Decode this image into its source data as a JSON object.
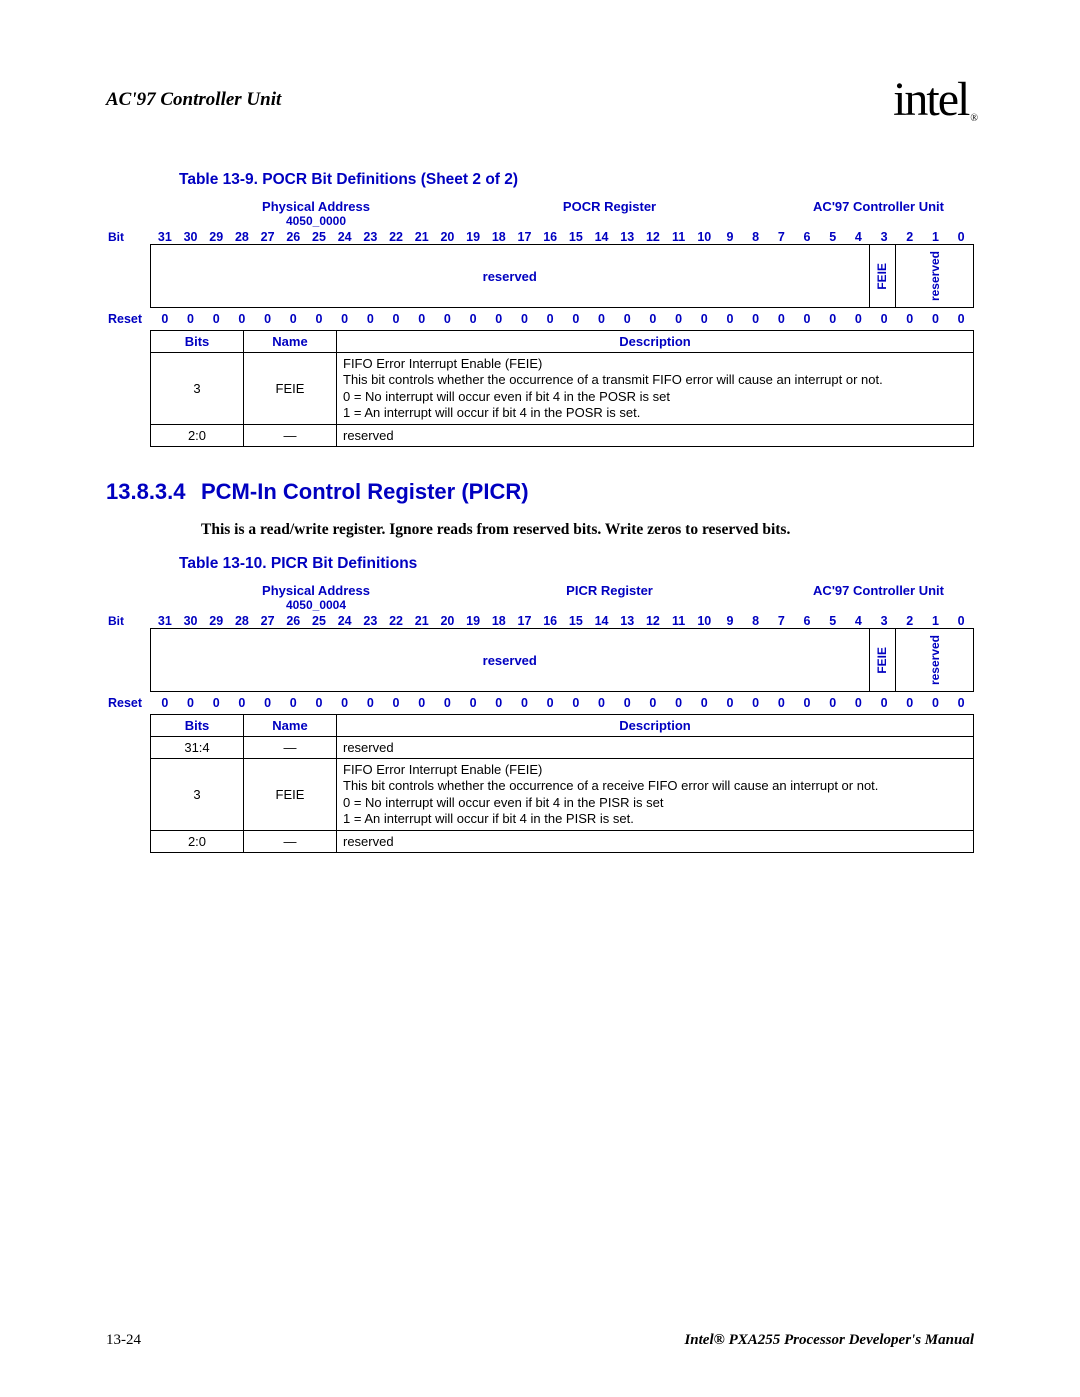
{
  "header": {
    "title": "AC'97 Controller Unit",
    "logo_text": "intel",
    "logo_r": "®"
  },
  "table1": {
    "caption": "Table 13-9. POCR Bit Definitions (Sheet 2 of 2)",
    "phys_addr_label": "Physical Address",
    "phys_addr": "4050_0000",
    "reg_name": "POCR Register",
    "unit": "AC'97 Controller Unit",
    "bit_label": "Bit",
    "bits": [
      "31",
      "30",
      "29",
      "28",
      "27",
      "26",
      "25",
      "24",
      "23",
      "22",
      "21",
      "20",
      "19",
      "18",
      "17",
      "16",
      "15",
      "14",
      "13",
      "12",
      "11",
      "10",
      "9",
      "8",
      "7",
      "6",
      "5",
      "4",
      "3",
      "2",
      "1",
      "0"
    ],
    "field_reserved": "reserved",
    "field_feie": "FEIE",
    "field_res2": "reserved",
    "reset_label": "Reset",
    "reset": [
      "0",
      "0",
      "0",
      "0",
      "0",
      "0",
      "0",
      "0",
      "0",
      "0",
      "0",
      "0",
      "0",
      "0",
      "0",
      "0",
      "0",
      "0",
      "0",
      "0",
      "0",
      "0",
      "0",
      "0",
      "0",
      "0",
      "0",
      "0",
      "0",
      "0",
      "0",
      "0"
    ],
    "th_bits": "Bits",
    "th_name": "Name",
    "th_desc": "Description",
    "row1": {
      "bits": "3",
      "name": "FEIE",
      "d1": "FIFO Error Interrupt Enable (FEIE)",
      "d2": "This bit controls whether the occurrence of a transmit FIFO error will cause an interrupt or not.",
      "d3": "0 =  No interrupt will occur even if bit 4 in the POSR is set",
      "d4": "1 =  An interrupt will occur if bit 4 in the POSR is set."
    },
    "row2": {
      "bits": "2:0",
      "name": "—",
      "desc": "reserved"
    }
  },
  "section": {
    "num": "13.8.3.4",
    "title": "PCM-In Control Register (PICR)",
    "body": "This is a read/write register. Ignore reads from reserved bits. Write zeros to reserved bits."
  },
  "table2": {
    "caption": "Table 13-10. PICR Bit Definitions",
    "phys_addr_label": "Physical Address",
    "phys_addr": "4050_0004",
    "reg_name": "PICR Register",
    "unit": "AC'97 Controller Unit",
    "bit_label": "Bit",
    "bits": [
      "31",
      "30",
      "29",
      "28",
      "27",
      "26",
      "25",
      "24",
      "23",
      "22",
      "21",
      "20",
      "19",
      "18",
      "17",
      "16",
      "15",
      "14",
      "13",
      "12",
      "11",
      "10",
      "9",
      "8",
      "7",
      "6",
      "5",
      "4",
      "3",
      "2",
      "1",
      "0"
    ],
    "field_reserved": "reserved",
    "field_feie": "FEIE",
    "field_res2": "reserved",
    "reset_label": "Reset",
    "reset": [
      "0",
      "0",
      "0",
      "0",
      "0",
      "0",
      "0",
      "0",
      "0",
      "0",
      "0",
      "0",
      "0",
      "0",
      "0",
      "0",
      "0",
      "0",
      "0",
      "0",
      "0",
      "0",
      "0",
      "0",
      "0",
      "0",
      "0",
      "0",
      "0",
      "0",
      "0",
      "0"
    ],
    "th_bits": "Bits",
    "th_name": "Name",
    "th_desc": "Description",
    "row0": {
      "bits": "31:4",
      "name": "—",
      "desc": "reserved"
    },
    "row1": {
      "bits": "3",
      "name": "FEIE",
      "d1": "FIFO Error Interrupt Enable (FEIE)",
      "d2": "This bit controls whether the occurrence of a receive FIFO error will cause an interrupt or not.",
      "d3": "0 =  No interrupt will occur even if bit 4 in the PISR is set",
      "d4": "1 =  An interrupt will occur if bit 4 in the PISR is set."
    },
    "row2": {
      "bits": "2:0",
      "name": "—",
      "desc": "reserved"
    }
  },
  "footer": {
    "page": "13-24",
    "manual": "Intel® PXA255 Processor Developer's Manual"
  }
}
